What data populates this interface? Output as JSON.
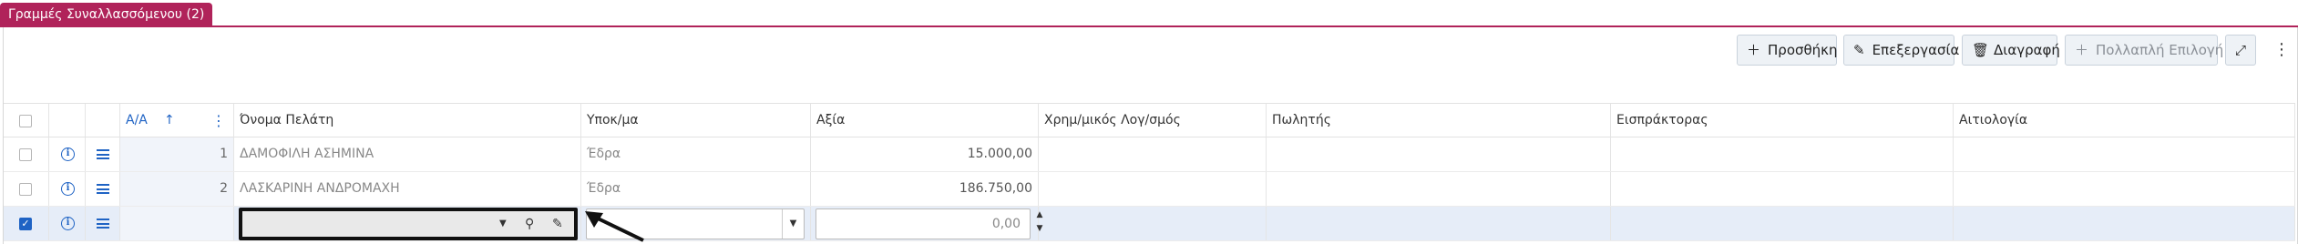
{
  "tab": {
    "label": "Γραμμές Συναλλασσόμενου (2)"
  },
  "toolbar": {
    "add_label": "Προσθήκη",
    "edit_label": "Επεξεργασία",
    "delete_label": "Διαγραφή",
    "multi_label": "Πολλαπλή Επιλογή"
  },
  "columns": {
    "aa": "Α/Α",
    "name": "Όνομα Πελάτη",
    "ypokatastima": "Υποκ/μα",
    "value": "Αξία",
    "account": "Χρημ/μικός Λογ/σμός",
    "seller": "Πωλητής",
    "collector": "Εισπράκτορας",
    "reason": "Αιτιολογία"
  },
  "rows": [
    {
      "aa": "1",
      "name": "ΔΑΜΟΦΙΛΗ ΑΣΗΜΙΝΑ",
      "ypokatastima": "Έδρα",
      "value": "15.000,00",
      "account": "",
      "seller": "",
      "collector": "",
      "reason": ""
    },
    {
      "aa": "2",
      "name": "ΛΑΣΚΑΡΙΝΗ ΑΝΔΡΟΜΑΧΗ",
      "ypokatastima": "Έδρα",
      "value": "186.750,00",
      "account": "",
      "seller": "",
      "collector": "",
      "reason": ""
    }
  ],
  "edit_row": {
    "name_value": "",
    "ypokatastima_value": "",
    "value": "0,00",
    "checked": true
  },
  "colors": {
    "accent": "#b0235a",
    "primary": "#1f63c4",
    "selected_row": "#e6edf8"
  },
  "icons": [
    "plus-icon",
    "pencil-icon",
    "trash-icon",
    "expand-icon",
    "kebab-icon",
    "info-icon",
    "menu-icon",
    "sort-up-icon",
    "search-icon",
    "chevron-down-icon",
    "arrow-icon"
  ]
}
